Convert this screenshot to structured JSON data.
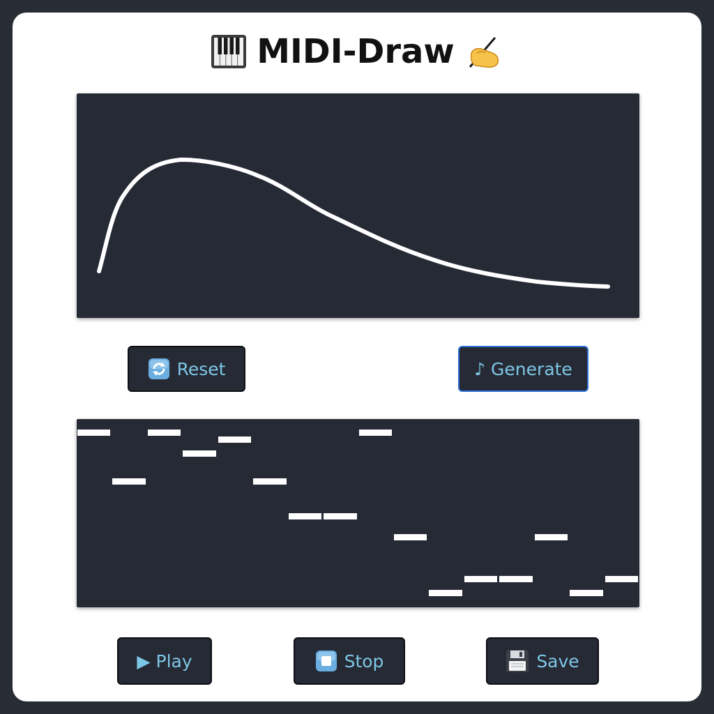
{
  "app": {
    "title": "MIDI-Draw"
  },
  "controls": {
    "reset_label": "Reset",
    "generate_label": "♪ Generate",
    "play_label": "▶ Play",
    "stop_label": "Stop",
    "save_label": "Save"
  },
  "icons": {
    "title_left": "piano-keys-icon",
    "title_right": "writing-hand-icon",
    "reset": "reset-cycle-icon",
    "stop": "stop-square-icon",
    "save": "floppy-disk-icon"
  },
  "colors": {
    "background": "#282c35",
    "card": "#ffffff",
    "canvas": "#262a35",
    "button_text": "#7dc7e6",
    "focus_ring": "#2f6fd8",
    "stroke": "#ffffff"
  },
  "piano_roll": {
    "steps": 16,
    "pitch_rows": 25,
    "notes": [
      {
        "step": 0,
        "pitch": 24
      },
      {
        "step": 1,
        "pitch": 17
      },
      {
        "step": 2,
        "pitch": 24
      },
      {
        "step": 3,
        "pitch": 21
      },
      {
        "step": 4,
        "pitch": 23
      },
      {
        "step": 5,
        "pitch": 17
      },
      {
        "step": 6,
        "pitch": 12
      },
      {
        "step": 7,
        "pitch": 12
      },
      {
        "step": 8,
        "pitch": 24
      },
      {
        "step": 9,
        "pitch": 9
      },
      {
        "step": 10,
        "pitch": 1
      },
      {
        "step": 11,
        "pitch": 3
      },
      {
        "step": 12,
        "pitch": 3
      },
      {
        "step": 13,
        "pitch": 9
      },
      {
        "step": 14,
        "pitch": 1
      },
      {
        "step": 15,
        "pitch": 3
      }
    ]
  }
}
